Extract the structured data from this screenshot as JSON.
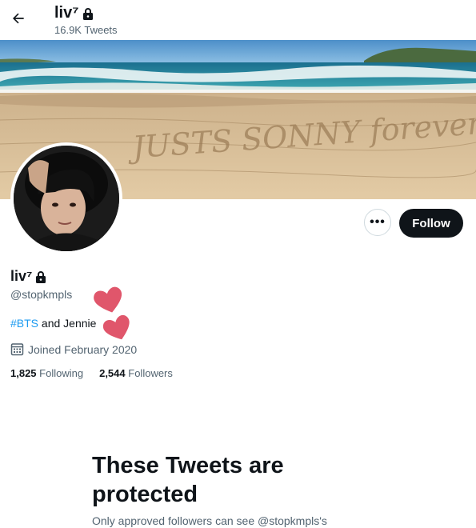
{
  "header": {
    "display_name": "liv⁷",
    "tweet_count": "16.9K Tweets"
  },
  "banner": {
    "sand_writing": "JUSTS SONNY forever"
  },
  "actions": {
    "more_label": "•••",
    "follow_label": "Follow"
  },
  "profile": {
    "display_name": "liv⁷",
    "handle": "@stopkmpls",
    "bio_hashtag": "#BTS",
    "bio_text": " and Jennie",
    "joined": "Joined February 2020",
    "following_count": "1,825",
    "following_label": "Following",
    "followers_count": "2,544",
    "followers_label": "Followers"
  },
  "protected": {
    "title": "These Tweets are protected",
    "text": "Only approved followers can see @stopkmpls's"
  },
  "colors": {
    "accent": "#1d9bf0",
    "text_primary": "#0f1419",
    "text_secondary": "#536471",
    "heart": "#e0566b"
  }
}
